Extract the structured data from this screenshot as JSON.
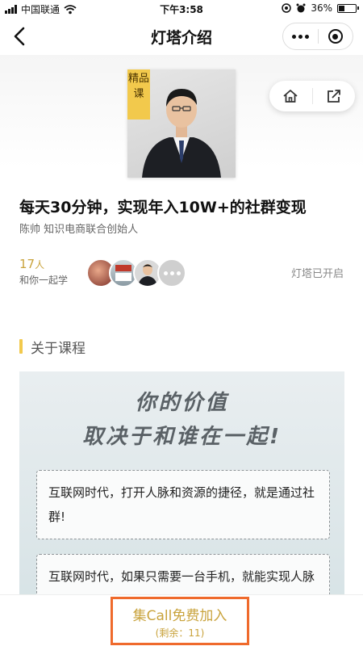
{
  "status_bar": {
    "carrier": "中国联通",
    "time": "下午3:58",
    "battery": "36%",
    "battery_level": 0.36
  },
  "nav": {
    "title": "灯塔介绍"
  },
  "cover": {
    "badge": "精品课"
  },
  "course": {
    "title": "每天30分钟，实现年入10W+的社群变现",
    "author": "陈帅 知识电商联合创始人"
  },
  "learners": {
    "count": "17",
    "unit": "人",
    "subtitle": "和你一起学",
    "status": "灯塔已开启"
  },
  "section": {
    "title": "关于课程"
  },
  "promo": {
    "headline_1": "你的价值",
    "headline_2": "取决于和谁在一起!",
    "card_1": "互联网时代，打开人脉和资源的捷径，就是通过社群!",
    "card_2": "互联网时代，如果只需要一台手机，就能实现人脉钱脉双丰收的玩法"
  },
  "join": {
    "label": "集Call免费加入",
    "remaining": "(剩余：11)"
  },
  "colors": {
    "accent_gold": "#c9a33c",
    "badge_yellow": "#f2c94c",
    "highlight_orange": "#ef6a2c"
  }
}
